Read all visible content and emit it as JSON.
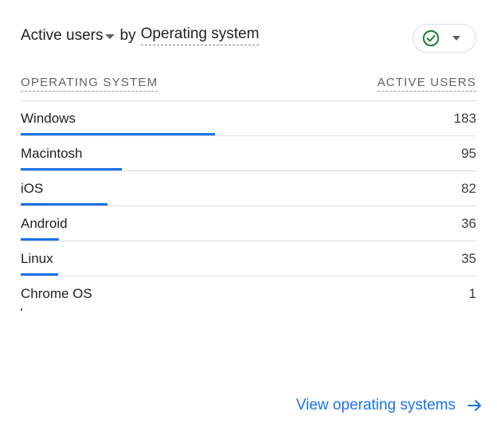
{
  "header": {
    "metric": "Active users",
    "connector": "by",
    "dimension": "Operating system",
    "status_icon": "check-circle-icon",
    "status_color": "#188038"
  },
  "table": {
    "columns": {
      "dimension": "OPERATING SYSTEM",
      "metric": "ACTIVE USERS"
    },
    "rows": [
      {
        "label": "Windows",
        "value": "183"
      },
      {
        "label": "Macintosh",
        "value": "95"
      },
      {
        "label": "iOS",
        "value": "82"
      },
      {
        "label": "Android",
        "value": "36"
      },
      {
        "label": "Linux",
        "value": "35"
      },
      {
        "label": "Chrome OS",
        "value": "1"
      }
    ],
    "bar_color": "#1a73e8"
  },
  "footer": {
    "link_label": "View operating systems",
    "link_icon": "arrow-right-icon"
  }
}
